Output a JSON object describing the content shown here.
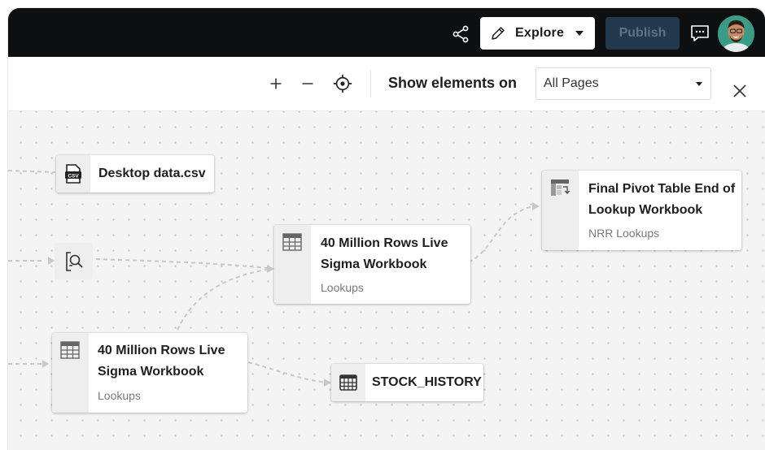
{
  "header": {
    "explore_label": "Explore",
    "publish_label": "Publish",
    "share_icon": "share-icon",
    "comment_icon": "comment-icon"
  },
  "toolbar": {
    "show_elements_label": "Show elements on",
    "pages_value": "All Pages"
  },
  "nodes": {
    "csv": {
      "title": "Desktop data.csv",
      "icon": "csv-file-icon"
    },
    "workbook_mid": {
      "title_line1": "40 Million Rows Live",
      "title_line2": "Sigma Workbook",
      "subtitle": "Lookups",
      "icon": "table-icon"
    },
    "workbook_low": {
      "title_line1": "40 Million Rows Live",
      "title_line2": "Sigma Workbook",
      "subtitle": "Lookups",
      "icon": "table-icon"
    },
    "pivot": {
      "title_line1": "Final Pivot Table End of",
      "title_line2": "Lookup Workbook",
      "subtitle": "NRR Lookups",
      "icon": "pivot-table-icon"
    },
    "stock": {
      "title": "STOCK_HISTORY",
      "icon": "database-table-icon"
    },
    "lookup": {
      "icon": "lookup-icon"
    }
  },
  "colors": {
    "topbar": "#0e0f11",
    "publish_bg": "#20394d",
    "canvas_bg": "#f4f4f4",
    "connector": "#c8c8c8"
  }
}
